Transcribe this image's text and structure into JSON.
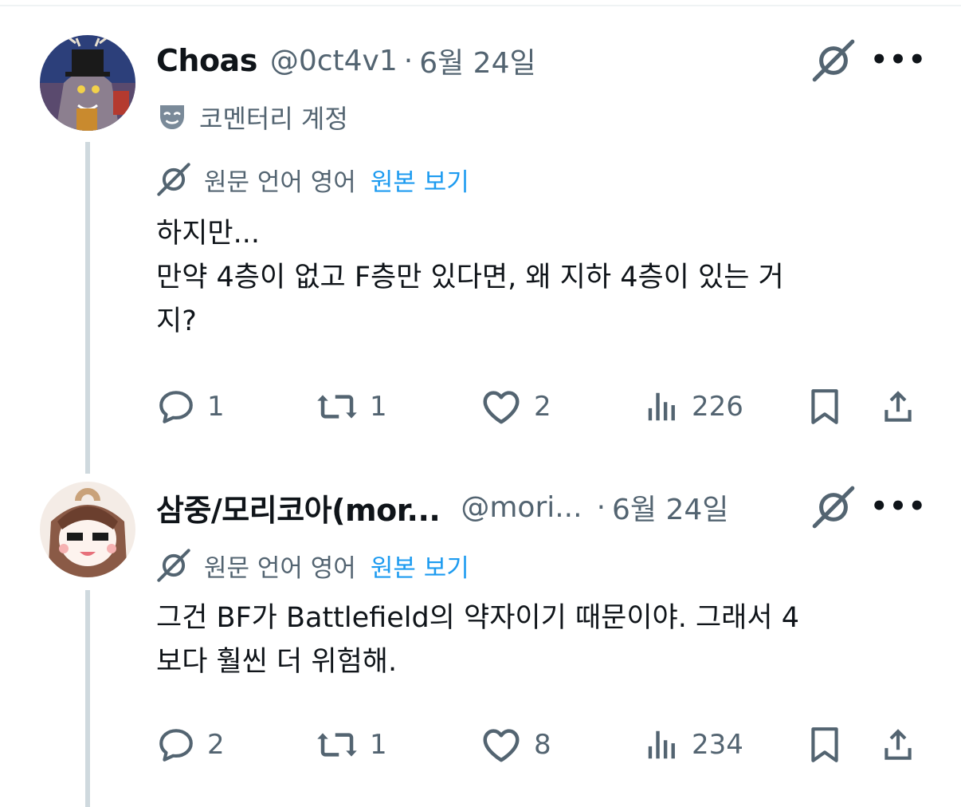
{
  "tweets": [
    {
      "display_name": "Choas",
      "handle": "@0ct4v1",
      "separator": "·",
      "date": "6월 24일",
      "label": "코멘터리 계정",
      "translation": {
        "source_text": "원문 언어 영어",
        "view_original": "원본 보기"
      },
      "body": [
        "하지만...",
        "만약 4층이 없고 F층만 있다면, 왜 지하 4층이 있는 거",
        "지?"
      ],
      "stats": {
        "replies": "1",
        "reposts": "1",
        "likes": "2",
        "views": "226"
      },
      "icons": {
        "label": "theater-mask-icon",
        "reply": "reply-icon",
        "repost": "repost-icon",
        "like": "heart-icon",
        "views": "views-icon",
        "bookmark": "bookmark-icon",
        "share": "share-icon"
      }
    },
    {
      "display_name": "삼중/모리코아(mor...",
      "handle": "@mori...",
      "separator": "·",
      "date": "6월 24일",
      "translation": {
        "source_text": "원문 언어 영어",
        "view_original": "원본 보기"
      },
      "body": [
        "그건 BF가 Battlefield의 약자이기 때문이야. 그래서 4",
        "보다 훨씬 더 위험해."
      ],
      "stats": {
        "replies": "2",
        "reposts": "1",
        "likes": "8",
        "views": "234"
      },
      "icons": {
        "reply": "reply-icon",
        "repost": "repost-icon",
        "like": "heart-icon",
        "views": "views-icon",
        "bookmark": "bookmark-icon",
        "share": "share-icon"
      }
    }
  ],
  "colors": {
    "text": "#0f1419",
    "secondary": "#536471",
    "link": "#1d9bf0",
    "thread_line": "#cfd9de"
  }
}
